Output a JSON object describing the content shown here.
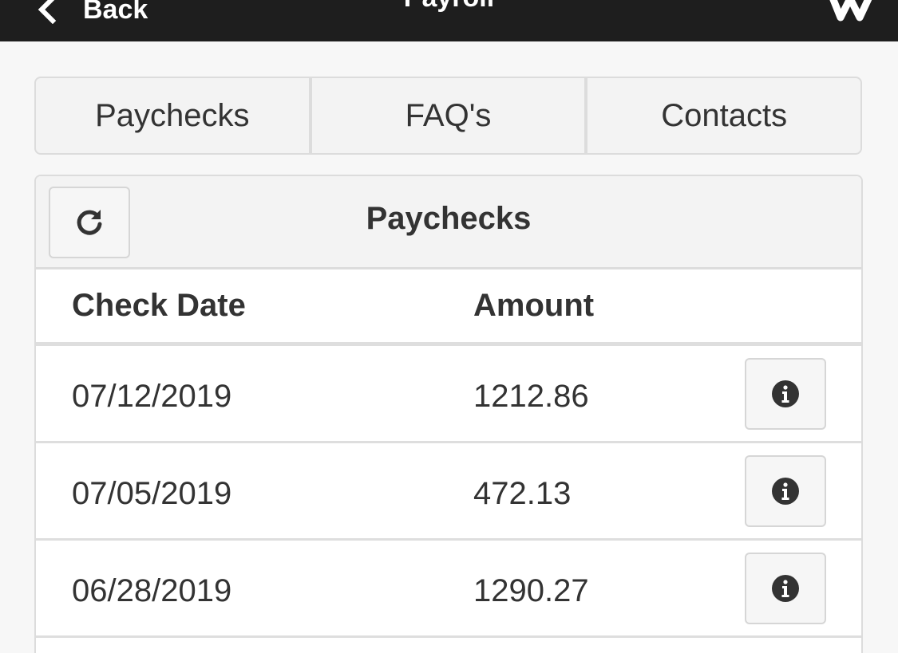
{
  "topbar": {
    "back_label": "Back",
    "title": "Payroll",
    "back_icon": "chevron-left-icon",
    "logo_icon": "brand-logo-icon"
  },
  "nav": {
    "tabs": [
      {
        "label": "Paychecks"
      },
      {
        "label": "FAQ's"
      },
      {
        "label": "Contacts"
      }
    ]
  },
  "panel": {
    "title": "Paychecks",
    "refresh_icon": "refresh-icon",
    "columns": {
      "check_date": "Check Date",
      "amount": "Amount"
    },
    "rows": [
      {
        "check_date": "07/12/2019",
        "amount": "1212.86"
      },
      {
        "check_date": "07/05/2019",
        "amount": "472.13"
      },
      {
        "check_date": "06/28/2019",
        "amount": "1290.27"
      }
    ],
    "row_action_icon": "info-icon"
  },
  "colors": {
    "topbar_bg": "#1e1e1e",
    "page_bg": "#f7f7f7",
    "border": "#dcdcdc",
    "text": "#333333"
  }
}
